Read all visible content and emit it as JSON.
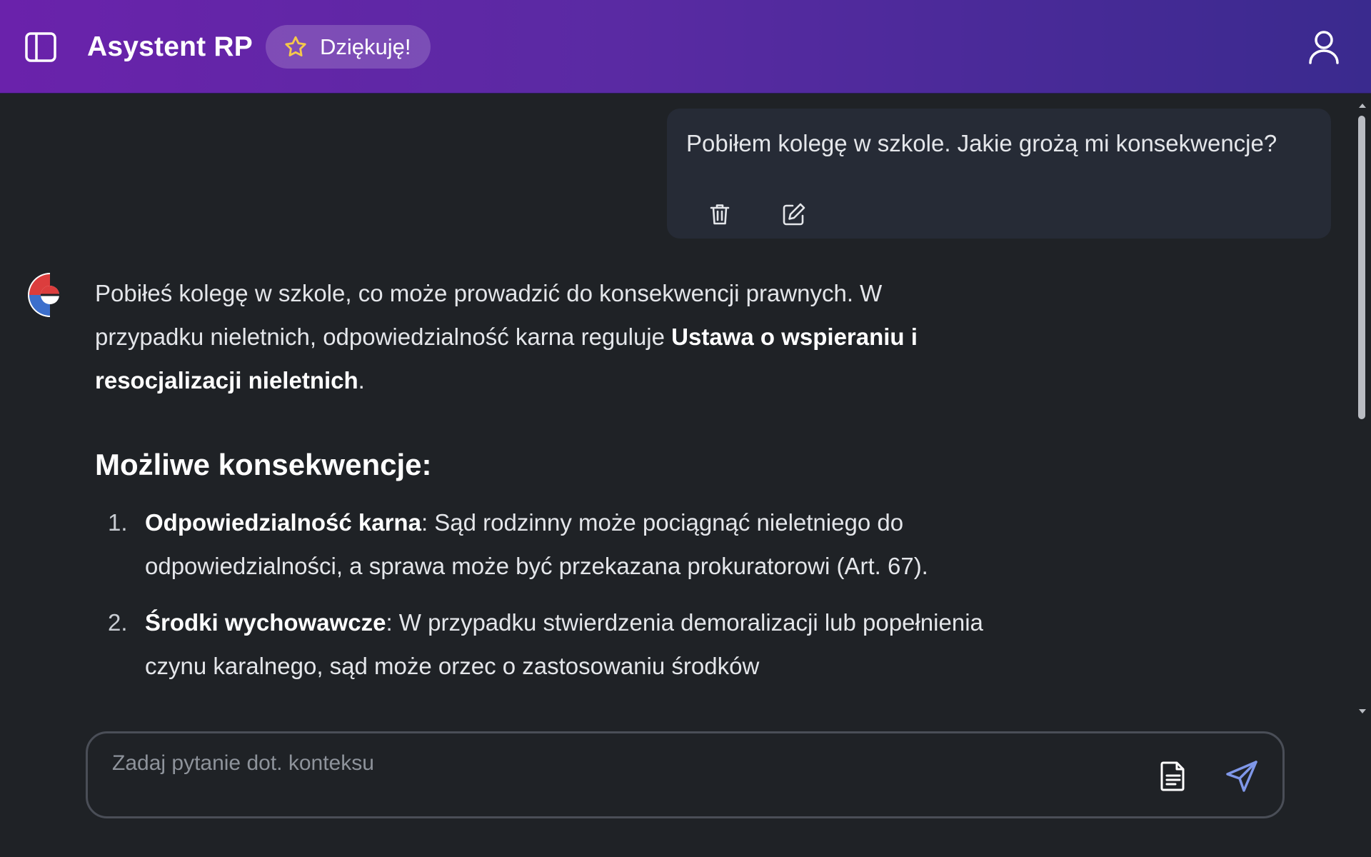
{
  "header": {
    "title": "Asystent RP",
    "thanks_label": "Dziękuję!"
  },
  "conversation": {
    "user_message": "Pobiłem kolegę w szkole. Jakie grożą mi konsekwencje?",
    "answer": {
      "intro_plain_1": "Pobiłeś kolegę w szkole, co może prowadzić do konsekwencji prawnych. W przypadku nieletnich, odpowiedzialność karna reguluje ",
      "intro_bold": "Ustawa o wspieraniu i resocjalizacji nieletnich",
      "intro_plain_2": ".",
      "heading": "Możliwe konsekwencje:",
      "items": [
        {
          "number": "1.",
          "bold": "Odpowiedzialność karna",
          "text": ": Sąd rodzinny może pociągnąć nieletniego do odpowiedzialności, a sprawa może być przekazana prokuratorowi (Art. 67)."
        },
        {
          "number": "2.",
          "bold": "Środki wychowawcze",
          "text": ": W przypadku stwierdzenia demoralizacji lub popełnienia czynu karalnego, sąd może orzec o zastosowaniu środków"
        }
      ]
    }
  },
  "input": {
    "placeholder": "Zadaj pytanie dot. konteksu",
    "value": ""
  },
  "icons": {
    "sidebar": "sidebar-toggle-icon",
    "star": "star-icon",
    "user": "user-icon",
    "delete": "trash-icon",
    "edit": "edit-icon",
    "avatar": "assistant-logo-icon",
    "document": "document-icon",
    "send": "send-icon"
  },
  "colors": {
    "header_gradient_start": "#6a22ab",
    "header_gradient_end": "#3a2a8e",
    "background": "#1f2226",
    "user_bubble": "#262b36",
    "star_accent": "#f5c84a",
    "send_accent": "#7f97e8"
  }
}
